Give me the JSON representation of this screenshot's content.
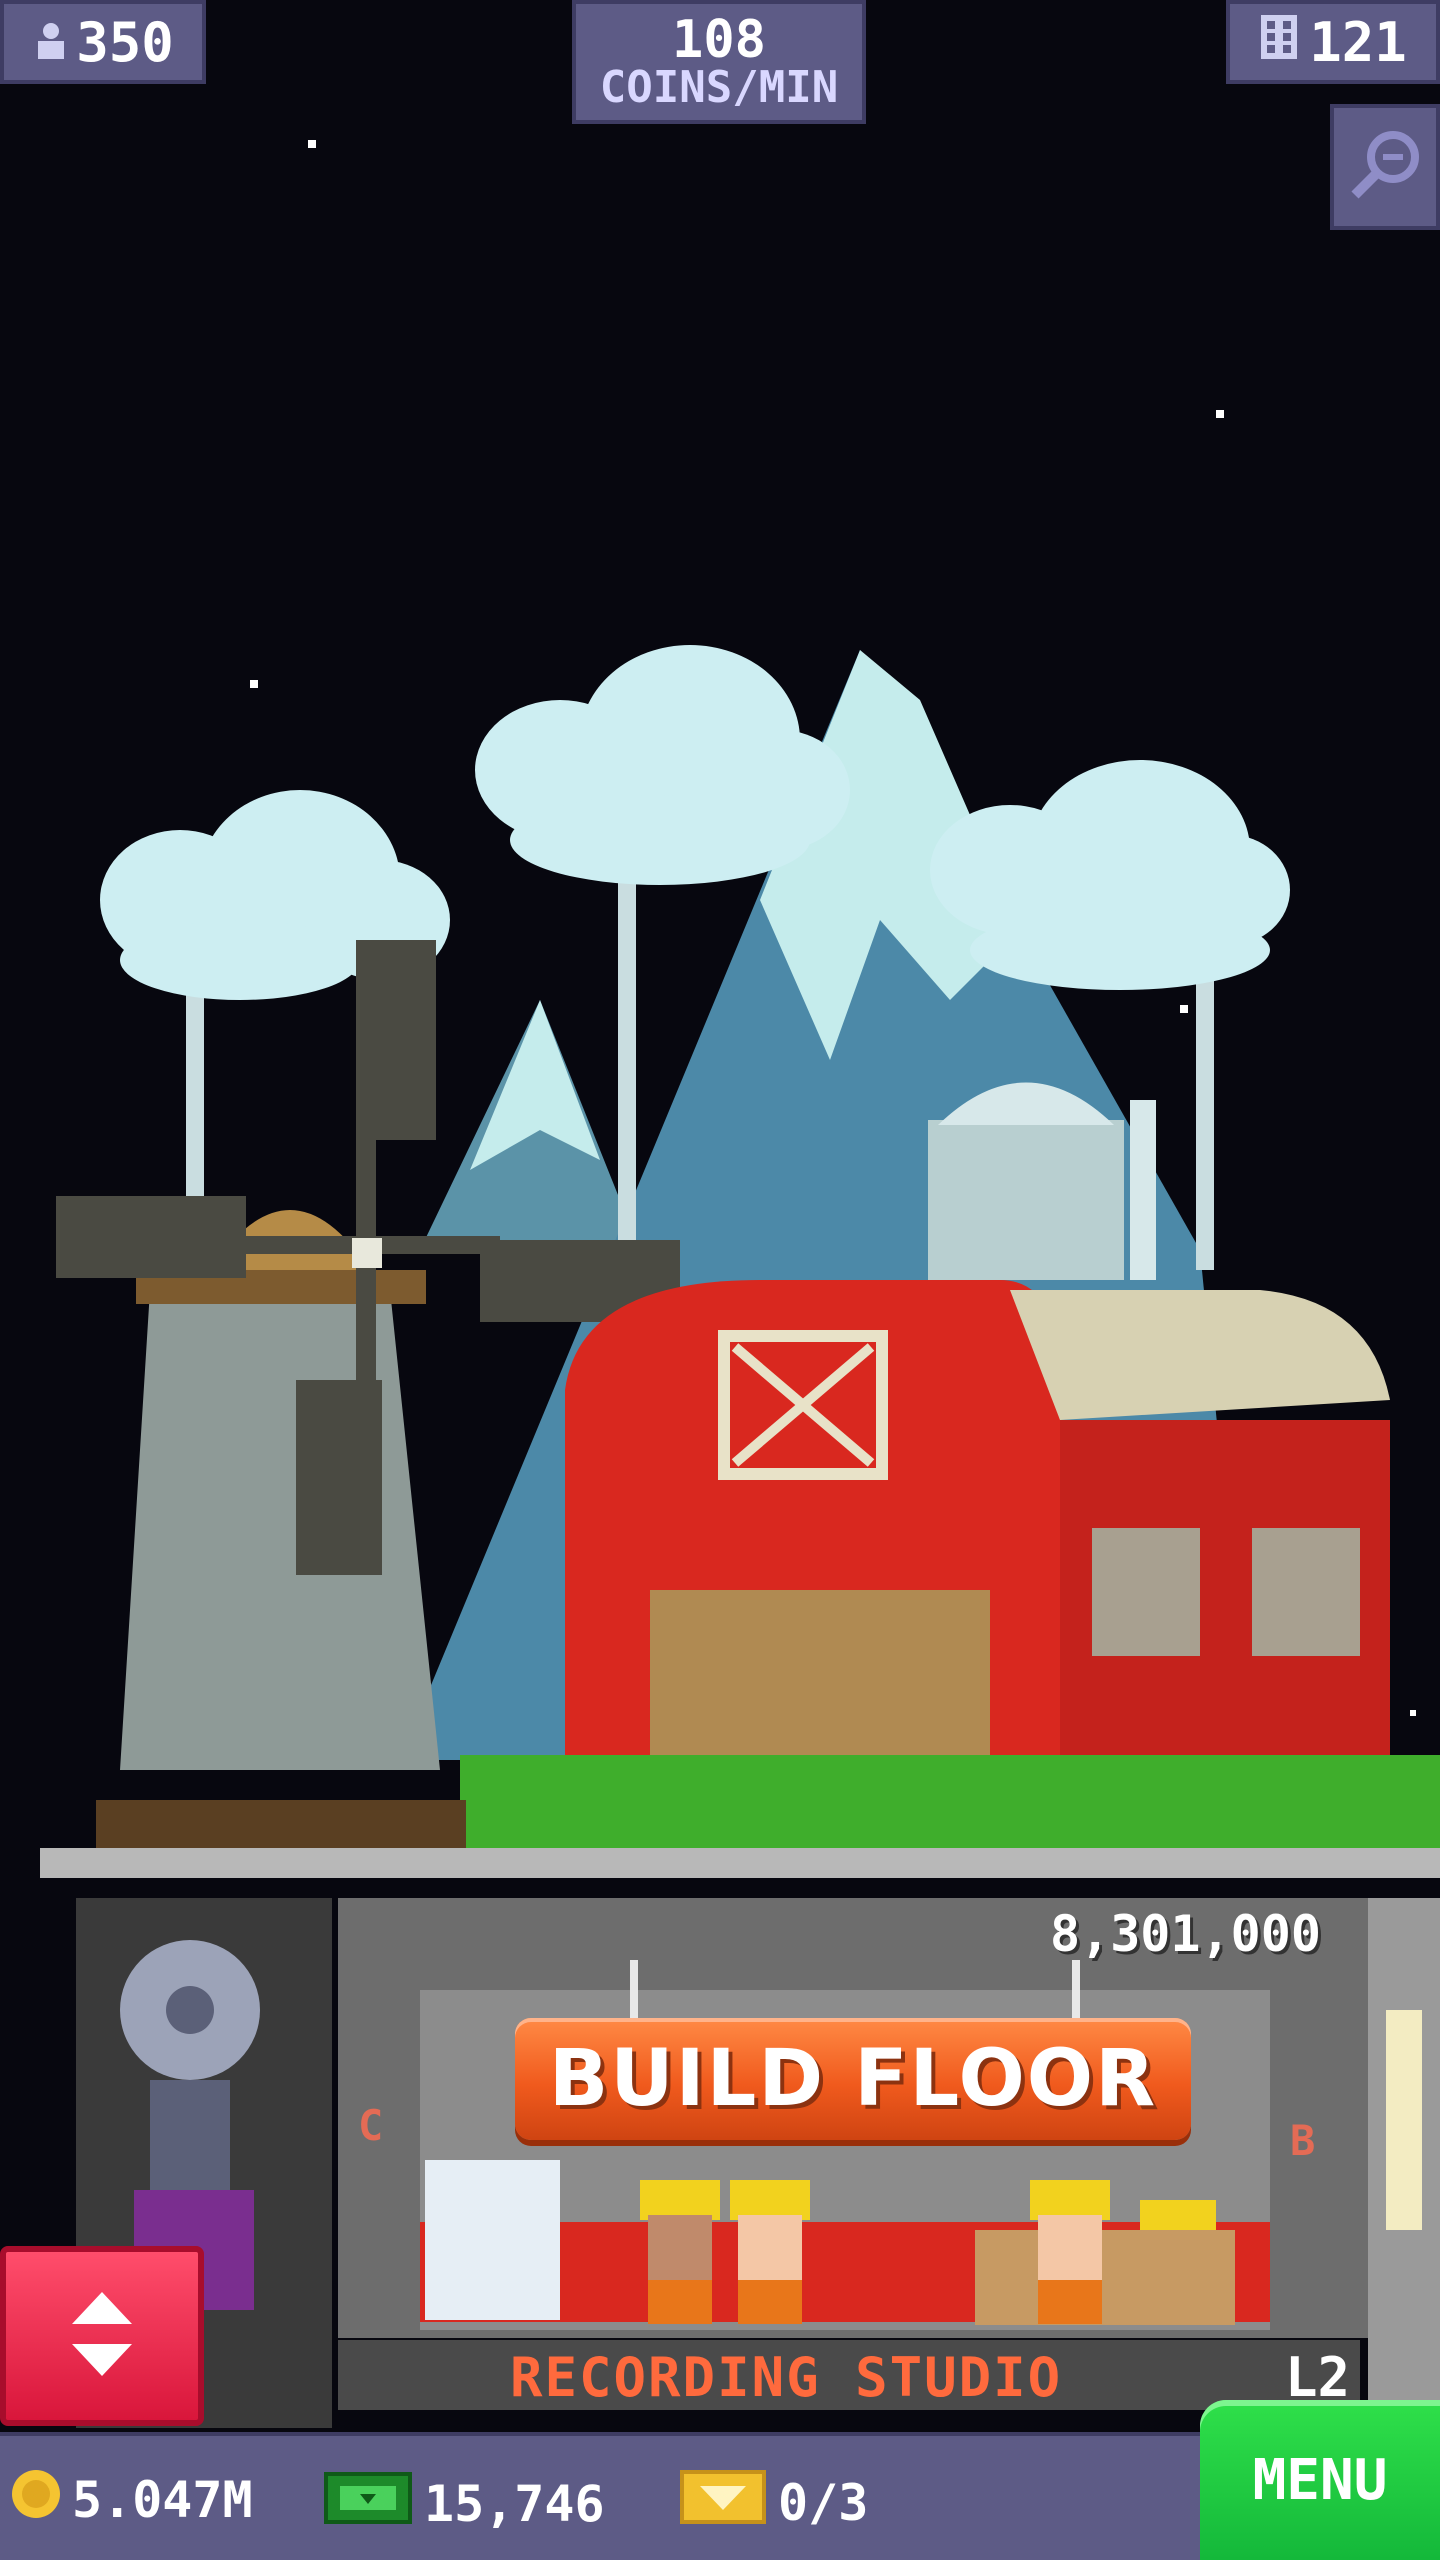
{
  "hud": {
    "population": "350",
    "coins_rate_value": "108",
    "coins_rate_unit": "COINS/MIN",
    "floor_count": "121"
  },
  "building": {
    "new_floor_cost": "8,301,000",
    "build_floor_label": "BUILD FLOOR",
    "floor_name": "RECORDING STUDIO",
    "floor_level": "L2",
    "side_letter_left": "C",
    "side_letter_right": "B"
  },
  "resources": {
    "coins": "5.047M",
    "bux": "15,746",
    "tickets": "0/3"
  },
  "menu_label": "MENU",
  "colors": {
    "hud_bg": "#5d5b86",
    "build_button": "#f05a1d",
    "menu_button": "#14b83a",
    "elevator_button": "#d9163b",
    "floor_name_text": "#ff6a3d"
  },
  "icons": {
    "population": "person-icon",
    "floors": "building-icon",
    "zoom": "zoom-out-icon",
    "coins": "coin-icon",
    "bux": "bux-icon",
    "tickets": "ticket-icon",
    "elevator": "up-down-arrows-icon"
  }
}
